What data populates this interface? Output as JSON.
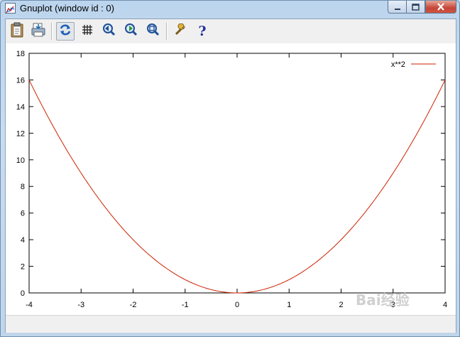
{
  "window": {
    "title": "Gnuplot (window id : 0)"
  },
  "toolbar": {
    "buttons": [
      {
        "icon": "clipboard-icon"
      },
      {
        "icon": "print-icon"
      },
      {
        "icon": "replot-icon"
      },
      {
        "icon": "grid-icon"
      },
      {
        "icon": "zoom-previous-icon"
      },
      {
        "icon": "zoom-next-icon"
      },
      {
        "icon": "unzoom-icon"
      },
      {
        "icon": "options-wrench-icon"
      },
      {
        "icon": "help-icon"
      }
    ]
  },
  "chart_data": {
    "type": "line",
    "title": "",
    "xlabel": "",
    "ylabel": "",
    "xlim": [
      -4,
      4
    ],
    "ylim": [
      0,
      18
    ],
    "xticks": [
      "-4",
      "-3",
      "-2",
      "-1",
      "0",
      "1",
      "2",
      "3",
      "4"
    ],
    "yticks": [
      "0",
      "2",
      "4",
      "6",
      "8",
      "10",
      "12",
      "14",
      "16",
      "18"
    ],
    "grid": false,
    "legend": "top-right",
    "series": [
      {
        "name": "x**2",
        "color": "#cc2200",
        "function": "x**2",
        "x": [
          -4,
          -3.5,
          -3,
          -2.5,
          -2,
          -1.5,
          -1,
          -0.5,
          0,
          0.5,
          1,
          1.5,
          2,
          2.5,
          3,
          3.5,
          4
        ],
        "y": [
          16,
          12.25,
          9,
          6.25,
          4,
          2.25,
          1,
          0.25,
          0,
          0.25,
          1,
          2.25,
          4,
          6.25,
          9,
          12.25,
          16
        ]
      }
    ]
  },
  "watermark": "Bai经验"
}
